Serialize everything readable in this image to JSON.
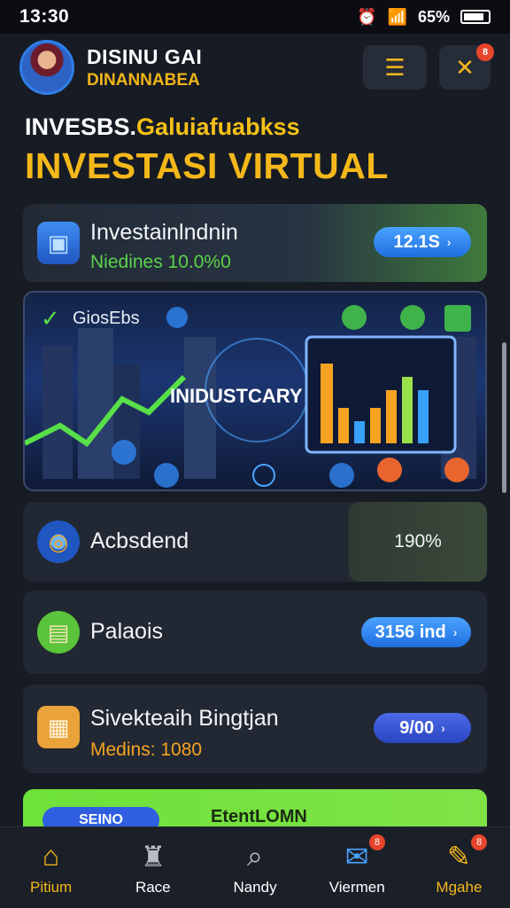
{
  "status_bar": {
    "time": "13:30",
    "battery": "65%"
  },
  "header": {
    "name": "DISINU GAI",
    "subtitle": "DINANNABEA",
    "menu_icon": "list-icon",
    "alert_icon": "bell-icon",
    "menu_glyph": "☰",
    "alert_glyph": "✕"
  },
  "hero": {
    "line_white": "INVESBS.",
    "line_accent": "Galuiafuabkss",
    "title": "INVESTASI VIRTUAL"
  },
  "cards": [
    {
      "title": "Investainlndnin",
      "meta": "Niedines 10.0%0",
      "value": "12.1S",
      "icon": "cube-icon",
      "accent": "#2fb84a"
    },
    {
      "title": "Acbsdend",
      "value": "190%",
      "icon": "target-icon"
    },
    {
      "title": "Palaois",
      "value": "3156 ind",
      "icon": "document-icon"
    },
    {
      "title": "Sivekteaih Bingtjan",
      "meta": "Medins: 1080",
      "value": "9/00",
      "icon": "folder-icon",
      "meta_color": "#f5a321"
    }
  ],
  "banner": {
    "badge": "GiosEbs",
    "label": "INIDUSTCARY",
    "check_icon": "check-icon",
    "dollar_icon": "dollar-icon"
  },
  "promo": {
    "left": "SEINO",
    "right": "EtentLOMN"
  },
  "nav": [
    {
      "label": "Pitium",
      "icon": "home-icon",
      "glyph": "⌂",
      "active": true
    },
    {
      "label": "Race",
      "icon": "user-icon",
      "glyph": "♜"
    },
    {
      "label": "Nandy",
      "icon": "search-icon",
      "glyph": "⌕"
    },
    {
      "label": "Viermen",
      "icon": "chat-icon",
      "glyph": "✉",
      "badge": "8"
    },
    {
      "label": "Mgahe",
      "icon": "edit-icon",
      "glyph": "✎",
      "badge": "8",
      "active": true
    }
  ],
  "colors": {
    "accent": "#f5b81a",
    "bg": "#161b24",
    "card": "#222833",
    "pill": "#2f86f0",
    "green": "#2fb84a"
  }
}
